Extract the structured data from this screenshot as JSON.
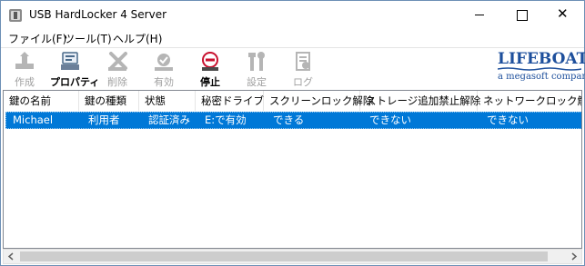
{
  "window": {
    "title": "USB HardLocker 4 Server",
    "close_glyph": "✕"
  },
  "menu": {
    "file": "ファイル(F)",
    "tool": "ツール(T)",
    "help": "ヘルプ(H)"
  },
  "toolbar": {
    "create": "作成",
    "properties": "プロパティ",
    "delete": "削除",
    "enable": "有効",
    "stop": "停止",
    "settings": "設定",
    "log": "ログ"
  },
  "logo": {
    "name": "LIFEBOAT",
    "tagline": "a megasoft company"
  },
  "table": {
    "columns": [
      "鍵の名前",
      "鍵の種類",
      "状態",
      "秘密ドライブ",
      "スクリーンロック解除",
      "ストレージ追加禁止解除",
      "ネットワークロック解除"
    ],
    "rows": [
      [
        "Michael",
        "利用者",
        "認証済み",
        "E:で有効",
        "できる",
        "できない",
        "できない"
      ]
    ]
  },
  "colors": {
    "selection": "#0078d7",
    "logo_blue": "#1d4f9c",
    "disabled_text": "#a0a0a0"
  }
}
